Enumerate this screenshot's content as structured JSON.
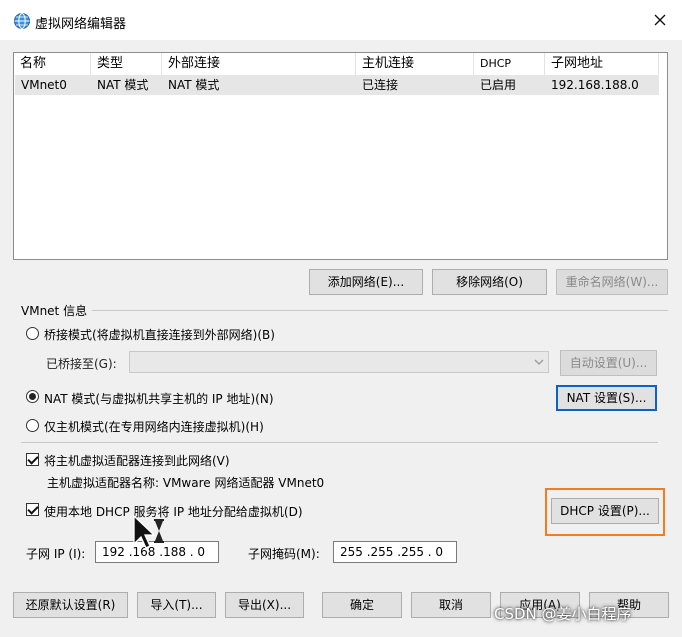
{
  "window": {
    "title": "虚拟网络编辑器"
  },
  "table": {
    "headers": [
      "名称",
      "类型",
      "外部连接",
      "主机连接",
      "DHCP",
      "子网地址"
    ],
    "rows": [
      [
        "VMnet0",
        "NAT 模式",
        "NAT 模式",
        "已连接",
        "已启用",
        "192.168.188.0"
      ]
    ]
  },
  "table_buttons": {
    "add": "添加网络(E)...",
    "remove": "移除网络(O)",
    "rename": "重命名网络(W)..."
  },
  "vmnet_info": {
    "label": "VMnet 信息",
    "bridge_mode": "桥接模式(将虚拟机直接连接到外部网络)(B)",
    "bridged_to": "已桥接至(G):",
    "auto_settings": "自动设置(U)...",
    "nat_mode": "NAT 模式(与虚拟机共享主机的 IP 地址)(N)",
    "nat_settings": "NAT 设置(S)...",
    "host_only": "仅主机模式(在专用网络内连接虚拟机)(H)",
    "connect_adapter": "将主机虚拟适配器连接到此网络(V)",
    "adapter_name": "主机虚拟适配器名称: VMware 网络适配器 VMnet0",
    "use_dhcp": "使用本地 DHCP 服务将 IP 地址分配给虚拟机(D)",
    "dhcp_settings": "DHCP 设置(P)...",
    "subnet_ip_label": "子网 IP (I):",
    "subnet_ip": "192 .168 .188 . 0",
    "subnet_mask_label": "子网掩码(M):",
    "subnet_mask": "255 .255 .255 . 0"
  },
  "footer": {
    "restore": "还原默认设置(R)",
    "import": "导入(T)...",
    "export": "导出(X)...",
    "ok": "确定",
    "cancel": "取消",
    "apply": "应用(A)",
    "help": "帮助"
  },
  "watermark": "CSDN @姜小白程序",
  "colors": {
    "highlight_box": "#f07d21",
    "focus_border": "#0a64c8",
    "selected_row": "#e6e6e6"
  },
  "icons": {
    "title": "network-globe-icon",
    "close": "close-icon",
    "combo": "chevron-down-icon",
    "cursor": "busy-cursor-icon"
  }
}
